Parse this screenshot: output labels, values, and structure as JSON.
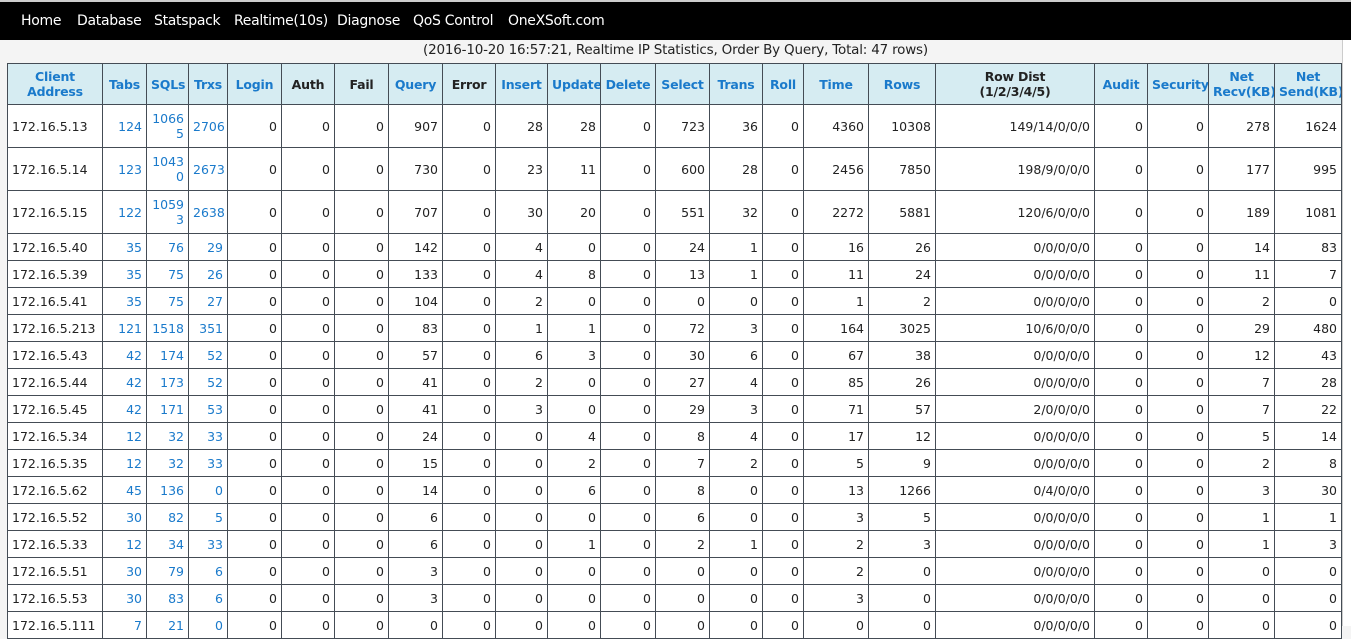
{
  "nav": {
    "items": [
      {
        "label": "Home"
      },
      {
        "label": "Database"
      },
      {
        "label": "Statspack"
      },
      {
        "label": "Realtime(10s)"
      },
      {
        "label": "Diagnose"
      },
      {
        "label": "QoS Control"
      },
      {
        "label": "OneXSoft.com"
      }
    ]
  },
  "subtitle": "(2016-10-20 16:57:21, Realtime IP Statistics, Order By Query, Total: 47 rows)",
  "colors": {
    "header_bg": "#d6ecf2",
    "link": "#1a7acb",
    "navbar_bg": "#000000"
  },
  "table": {
    "headers": [
      {
        "line1": "Client",
        "line2": "Address",
        "link": true
      },
      {
        "line1": "Tabs",
        "line2": "",
        "link": true
      },
      {
        "line1": "SQLs",
        "line2": "",
        "link": true
      },
      {
        "line1": "Trxs",
        "line2": "",
        "link": true
      },
      {
        "line1": "Login",
        "line2": "",
        "link": true
      },
      {
        "line1": "Auth",
        "line2": "",
        "link": false
      },
      {
        "line1": "Fail",
        "line2": "",
        "link": false
      },
      {
        "line1": "Query",
        "line2": "",
        "link": true
      },
      {
        "line1": "Error",
        "line2": "",
        "link": false
      },
      {
        "line1": "Insert",
        "line2": "",
        "link": true
      },
      {
        "line1": "Update",
        "line2": "",
        "link": true
      },
      {
        "line1": "Delete",
        "line2": "",
        "link": true
      },
      {
        "line1": "Select",
        "line2": "",
        "link": true
      },
      {
        "line1": "Trans",
        "line2": "",
        "link": true
      },
      {
        "line1": "Roll",
        "line2": "",
        "link": true
      },
      {
        "line1": "Time",
        "line2": "",
        "link": true
      },
      {
        "line1": "Rows",
        "line2": "",
        "link": true
      },
      {
        "line1": "Row Dist",
        "line2": "(1/2/3/4/5)",
        "link": false
      },
      {
        "line1": "Audit",
        "line2": "",
        "link": true
      },
      {
        "line1": "Security",
        "line2": "",
        "link": true
      },
      {
        "line1": "Net",
        "line2": "Recv(KB)",
        "link": true
      },
      {
        "line1": "Net",
        "line2": "Send(KB)",
        "link": true
      }
    ],
    "rows": [
      [
        "172.16.5.13",
        "124",
        "10665",
        "2706",
        "0",
        "0",
        "0",
        "907",
        "0",
        "28",
        "28",
        "0",
        "723",
        "36",
        "0",
        "4360",
        "10308",
        "149/14/0/0/0",
        "0",
        "0",
        "278",
        "1624"
      ],
      [
        "172.16.5.14",
        "123",
        "10430",
        "2673",
        "0",
        "0",
        "0",
        "730",
        "0",
        "23",
        "11",
        "0",
        "600",
        "28",
        "0",
        "2456",
        "7850",
        "198/9/0/0/0",
        "0",
        "0",
        "177",
        "995"
      ],
      [
        "172.16.5.15",
        "122",
        "10593",
        "2638",
        "0",
        "0",
        "0",
        "707",
        "0",
        "30",
        "20",
        "0",
        "551",
        "32",
        "0",
        "2272",
        "5881",
        "120/6/0/0/0",
        "0",
        "0",
        "189",
        "1081"
      ],
      [
        "172.16.5.40",
        "35",
        "76",
        "29",
        "0",
        "0",
        "0",
        "142",
        "0",
        "4",
        "0",
        "0",
        "24",
        "1",
        "0",
        "16",
        "26",
        "0/0/0/0/0",
        "0",
        "0",
        "14",
        "83"
      ],
      [
        "172.16.5.39",
        "35",
        "75",
        "26",
        "0",
        "0",
        "0",
        "133",
        "0",
        "4",
        "8",
        "0",
        "13",
        "1",
        "0",
        "11",
        "24",
        "0/0/0/0/0",
        "0",
        "0",
        "11",
        "7"
      ],
      [
        "172.16.5.41",
        "35",
        "75",
        "27",
        "0",
        "0",
        "0",
        "104",
        "0",
        "2",
        "0",
        "0",
        "0",
        "0",
        "0",
        "1",
        "2",
        "0/0/0/0/0",
        "0",
        "0",
        "2",
        "0"
      ],
      [
        "172.16.5.213",
        "121",
        "1518",
        "351",
        "0",
        "0",
        "0",
        "83",
        "0",
        "1",
        "1",
        "0",
        "72",
        "3",
        "0",
        "164",
        "3025",
        "10/6/0/0/0",
        "0",
        "0",
        "29",
        "480"
      ],
      [
        "172.16.5.43",
        "42",
        "174",
        "52",
        "0",
        "0",
        "0",
        "57",
        "0",
        "6",
        "3",
        "0",
        "30",
        "6",
        "0",
        "67",
        "38",
        "0/0/0/0/0",
        "0",
        "0",
        "12",
        "43"
      ],
      [
        "172.16.5.44",
        "42",
        "173",
        "52",
        "0",
        "0",
        "0",
        "41",
        "0",
        "2",
        "0",
        "0",
        "27",
        "4",
        "0",
        "85",
        "26",
        "0/0/0/0/0",
        "0",
        "0",
        "7",
        "28"
      ],
      [
        "172.16.5.45",
        "42",
        "171",
        "53",
        "0",
        "0",
        "0",
        "41",
        "0",
        "3",
        "0",
        "0",
        "29",
        "3",
        "0",
        "71",
        "57",
        "2/0/0/0/0",
        "0",
        "0",
        "7",
        "22"
      ],
      [
        "172.16.5.34",
        "12",
        "32",
        "33",
        "0",
        "0",
        "0",
        "24",
        "0",
        "0",
        "4",
        "0",
        "8",
        "4",
        "0",
        "17",
        "12",
        "0/0/0/0/0",
        "0",
        "0",
        "5",
        "14"
      ],
      [
        "172.16.5.35",
        "12",
        "32",
        "33",
        "0",
        "0",
        "0",
        "15",
        "0",
        "0",
        "2",
        "0",
        "7",
        "2",
        "0",
        "5",
        "9",
        "0/0/0/0/0",
        "0",
        "0",
        "2",
        "8"
      ],
      [
        "172.16.5.62",
        "45",
        "136",
        "0",
        "0",
        "0",
        "0",
        "14",
        "0",
        "0",
        "6",
        "0",
        "8",
        "0",
        "0",
        "13",
        "1266",
        "0/4/0/0/0",
        "0",
        "0",
        "3",
        "30"
      ],
      [
        "172.16.5.52",
        "30",
        "82",
        "5",
        "0",
        "0",
        "0",
        "6",
        "0",
        "0",
        "0",
        "0",
        "6",
        "0",
        "0",
        "3",
        "5",
        "0/0/0/0/0",
        "0",
        "0",
        "1",
        "1"
      ],
      [
        "172.16.5.33",
        "12",
        "34",
        "33",
        "0",
        "0",
        "0",
        "6",
        "0",
        "0",
        "1",
        "0",
        "2",
        "1",
        "0",
        "2",
        "3",
        "0/0/0/0/0",
        "0",
        "0",
        "1",
        "3"
      ],
      [
        "172.16.5.51",
        "30",
        "79",
        "6",
        "0",
        "0",
        "0",
        "3",
        "0",
        "0",
        "0",
        "0",
        "0",
        "0",
        "0",
        "2",
        "0",
        "0/0/0/0/0",
        "0",
        "0",
        "0",
        "0"
      ],
      [
        "172.16.5.53",
        "30",
        "83",
        "6",
        "0",
        "0",
        "0",
        "3",
        "0",
        "0",
        "0",
        "0",
        "0",
        "0",
        "0",
        "3",
        "0",
        "0/0/0/0/0",
        "0",
        "0",
        "0",
        "0"
      ],
      [
        "172.16.5.111",
        "7",
        "21",
        "0",
        "0",
        "0",
        "0",
        "0",
        "0",
        "0",
        "0",
        "0",
        "0",
        "0",
        "0",
        "0",
        "0",
        "0/0/0/0/0",
        "0",
        "0",
        "0",
        "0"
      ]
    ]
  }
}
